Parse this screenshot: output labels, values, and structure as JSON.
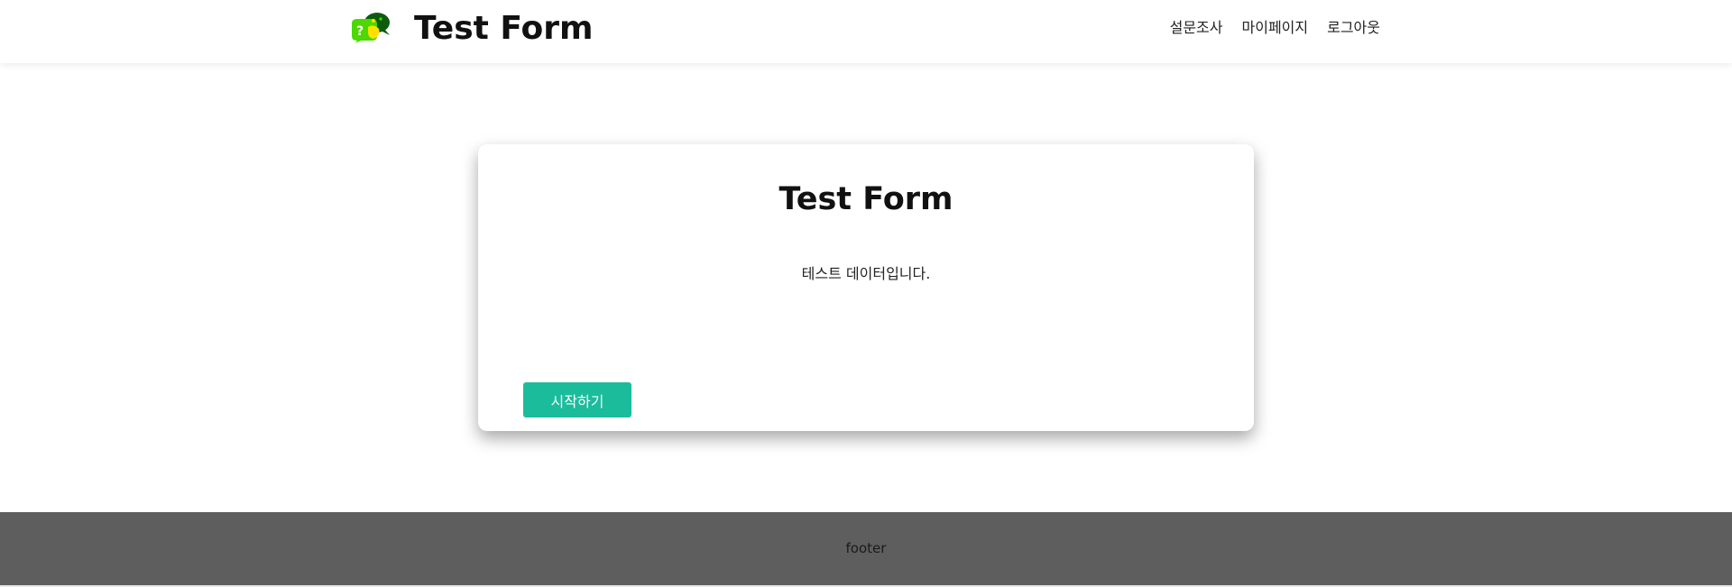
{
  "header": {
    "title": "Test Form",
    "nav": [
      {
        "label": "설문조사"
      },
      {
        "label": "마이페이지"
      },
      {
        "label": "로그아웃"
      }
    ]
  },
  "card": {
    "title": "Test Form",
    "description": "테스트 데이터입니다.",
    "start_label": "시작하기"
  },
  "footer": {
    "text": "footer"
  },
  "colors": {
    "accent": "#1abc9c",
    "footer_bg": "#5e5e5e",
    "logo_dark_green": "#0d5c0d",
    "logo_light_green": "#4cd800",
    "logo_yellow": "#ffe000"
  },
  "icons": {
    "logo": "chat-bubbles-question-logo"
  }
}
